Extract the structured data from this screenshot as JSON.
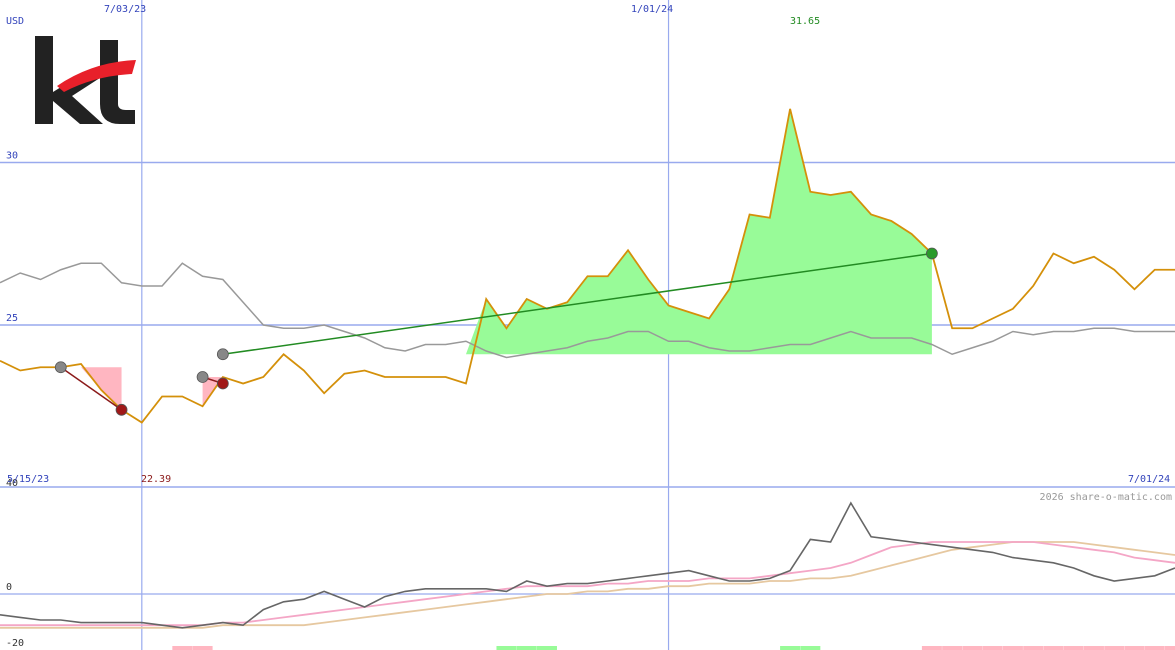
{
  "colors": {
    "price": "#d4900a",
    "benchmark": "#999999",
    "gain_fill": "#98fb98",
    "loss_fill": "#ffb6c1",
    "trend_up": "#228b22",
    "trend_down": "#8b1a1a",
    "grid": "#99aaee",
    "axis_text": "#3344bb",
    "osc": "#666666",
    "osc_ma_fast": "#f4a6c6",
    "osc_ma_slow": "#e6c8a0",
    "logo_dark": "#222222",
    "logo_red": "#e8202a"
  },
  "labels": {
    "currency": "USD",
    "top_left_date": "7/03/23",
    "top_mid_date": "1/01/24",
    "peak_value": "31.65",
    "min_value": "22.39",
    "start_date": "5/15/23",
    "end_date": "7/01/24",
    "copyright": "2026 share-o-matic.com"
  },
  "logo": {
    "text": "kt"
  },
  "chart_data": [
    {
      "type": "line",
      "y_ticks": [
        25,
        30
      ],
      "series": [
        {
          "x": [
            "5/15/23",
            "5/22/23",
            "5/29/23",
            "6/05/23",
            "6/12/23",
            "6/19/23",
            "6/26/23",
            "7/03/23",
            "7/10/23",
            "7/17/23",
            "7/24/23",
            "7/31/23",
            "8/07/23",
            "8/14/23",
            "8/21/23",
            "8/28/23",
            "9/04/23",
            "9/11/23",
            "9/18/23",
            "9/25/23",
            "10/02/23",
            "10/09/23",
            "10/16/23",
            "10/23/23",
            "10/30/23",
            "11/06/23",
            "11/13/23",
            "11/20/23",
            "11/27/23",
            "12/04/23",
            "12/11/23",
            "12/18/23",
            "12/25/23",
            "1/01/24",
            "1/08/24",
            "1/15/24",
            "1/22/24",
            "1/29/24",
            "2/05/24",
            "2/12/24",
            "2/19/24",
            "2/26/24",
            "3/04/24",
            "3/11/24",
            "3/18/24",
            "3/25/24",
            "4/01/24",
            "4/08/24",
            "4/15/24",
            "4/22/24",
            "4/29/24",
            "5/06/24",
            "5/13/24",
            "5/20/24",
            "5/27/24",
            "6/03/24",
            "6/10/24",
            "6/17/24",
            "6/24/24"
          ],
          "values": [
            23.9,
            23.6,
            23.7,
            23.7,
            23.8,
            23.0,
            22.39,
            22.0,
            22.8,
            22.8,
            22.5,
            23.4,
            23.2,
            23.4,
            24.1,
            23.6,
            22.9,
            23.5,
            23.6,
            23.4,
            23.4,
            23.4,
            23.4,
            23.2,
            25.8,
            24.9,
            25.8,
            25.5,
            25.7,
            26.5,
            26.5,
            27.3,
            26.4,
            25.6,
            25.4,
            25.2,
            26.1,
            28.4,
            28.3,
            31.65,
            29.1,
            29.0,
            29.1,
            28.4,
            28.2,
            27.8,
            27.2,
            24.9,
            24.9,
            25.2,
            25.5,
            26.2,
            27.2,
            26.9,
            27.1,
            26.7,
            26.1,
            26.7,
            26.7
          ]
        },
        {
          "x": [
            "5/15/23",
            "5/22/23",
            "5/29/23",
            "6/05/23",
            "6/12/23",
            "6/19/23",
            "6/26/23",
            "7/03/23",
            "7/10/23",
            "7/17/23",
            "7/24/23",
            "7/31/23",
            "8/07/23",
            "8/14/23",
            "8/21/23",
            "8/28/23",
            "9/04/23",
            "9/11/23",
            "9/18/23",
            "9/25/23",
            "10/02/23",
            "10/09/23",
            "10/16/23",
            "10/23/23",
            "10/30/23",
            "11/06/23",
            "11/13/23",
            "11/20/23",
            "11/27/23",
            "12/04/23",
            "12/11/23",
            "12/18/23",
            "12/25/23",
            "1/01/24",
            "1/08/24",
            "1/15/24",
            "1/22/24",
            "1/29/24",
            "2/05/24",
            "2/12/24",
            "2/19/24",
            "2/26/24",
            "3/04/24",
            "3/11/24",
            "3/18/24",
            "3/25/24",
            "4/01/24",
            "4/08/24",
            "4/15/24",
            "4/22/24",
            "4/29/24",
            "5/06/24",
            "5/13/24",
            "5/20/24",
            "5/27/24",
            "6/03/24",
            "6/10/24",
            "6/17/24",
            "6/24/24"
          ],
          "values": [
            26.3,
            26.6,
            26.4,
            26.7,
            26.9,
            26.9,
            26.3,
            26.2,
            26.2,
            26.9,
            26.5,
            26.4,
            25.7,
            25.0,
            24.9,
            24.9,
            25.0,
            24.8,
            24.6,
            24.3,
            24.2,
            24.4,
            24.4,
            24.5,
            24.2,
            24.0,
            24.1,
            24.2,
            24.3,
            24.5,
            24.6,
            24.8,
            24.8,
            24.5,
            24.5,
            24.3,
            24.2,
            24.2,
            24.3,
            24.4,
            24.4,
            24.6,
            24.8,
            24.6,
            24.6,
            24.6,
            24.4,
            24.1,
            24.3,
            24.5,
            24.8,
            24.7,
            24.8,
            24.8,
            24.9,
            24.9,
            24.8,
            24.8,
            24.8
          ]
        }
      ],
      "trend_lines": [
        {
          "from": [
            "6/05/23",
            23.7
          ],
          "to": [
            "6/26/23",
            22.39
          ],
          "direction": "down"
        },
        {
          "from": [
            "7/24/23",
            23.4
          ],
          "to": [
            "7/31/23",
            23.2
          ],
          "direction": "down"
        },
        {
          "from": [
            "7/31/23",
            24.1
          ],
          "to": [
            "4/01/24",
            27.2
          ],
          "direction": "up"
        }
      ],
      "markers": [
        {
          "x": "6/05/23",
          "y": 23.7,
          "kind": "gray"
        },
        {
          "x": "6/26/23",
          "y": 22.39,
          "kind": "red"
        },
        {
          "x": "7/24/23",
          "y": 23.4,
          "kind": "gray"
        },
        {
          "x": "7/31/23",
          "y": 23.2,
          "kind": "red"
        },
        {
          "x": "7/31/23",
          "y": 24.1,
          "kind": "gray"
        },
        {
          "x": "4/01/24",
          "y": 27.2,
          "kind": "green"
        }
      ],
      "shaded": [
        {
          "from": "6/05/23",
          "to": "6/26/23",
          "base": 23.7,
          "kind": "loss"
        },
        {
          "from": "7/24/23",
          "to": "7/31/23",
          "base": 23.4,
          "kind": "loss"
        },
        {
          "from": "7/31/23",
          "to": "4/01/24",
          "base": 24.1,
          "kind": "gain"
        }
      ]
    },
    {
      "type": "line",
      "y_ticks": [
        40,
        0,
        -20
      ],
      "series": [
        {
          "values": [
            -8,
            -9,
            -10,
            -10,
            -11,
            -11,
            -11,
            -11,
            -12,
            -13,
            -12,
            -11,
            -12,
            -6,
            -3,
            -2,
            1,
            -2,
            -5,
            -1,
            1,
            2,
            2,
            2,
            2,
            1,
            5,
            3,
            4,
            4,
            5,
            6,
            7,
            8,
            9,
            7,
            5,
            5,
            6,
            9,
            21,
            20,
            35,
            22,
            21,
            20,
            19,
            18,
            17,
            16,
            14,
            13,
            12,
            10,
            7,
            5,
            6,
            7,
            10
          ]
        },
        {
          "values": [
            -12,
            -12,
            -12,
            -12,
            -12,
            -12,
            -12,
            -12,
            -12,
            -12,
            -12,
            -11,
            -11,
            -10,
            -9,
            -8,
            -7,
            -6,
            -5,
            -4,
            -3,
            -2,
            -1,
            0,
            1,
            2,
            3,
            3,
            3,
            3,
            4,
            4,
            5,
            5,
            5,
            6,
            6,
            6,
            7,
            8,
            9,
            10,
            12,
            15,
            18,
            19,
            20,
            20,
            20,
            20,
            20,
            20,
            19,
            18,
            17,
            16,
            14,
            13,
            12
          ]
        },
        {
          "values": [
            -13,
            -13,
            -13,
            -13,
            -13,
            -13,
            -13,
            -13,
            -13,
            -13,
            -13,
            -12,
            -12,
            -12,
            -12,
            -12,
            -11,
            -10,
            -9,
            -8,
            -7,
            -6,
            -5,
            -4,
            -3,
            -2,
            -1,
            0,
            0,
            1,
            1,
            2,
            2,
            3,
            3,
            4,
            4,
            4,
            5,
            5,
            6,
            6,
            7,
            9,
            11,
            13,
            15,
            17,
            18,
            19,
            20,
            20,
            20,
            20,
            19,
            18,
            17,
            16,
            15
          ]
        }
      ],
      "bars": [
        {
          "x": "7/17/23",
          "kind": "loss"
        },
        {
          "x": "7/24/23",
          "kind": "loss"
        },
        {
          "x": "11/06/23",
          "kind": "gain"
        },
        {
          "x": "11/13/23",
          "kind": "gain"
        },
        {
          "x": "11/20/23",
          "kind": "gain"
        },
        {
          "x": "2/12/24",
          "kind": "gain"
        },
        {
          "x": "2/19/24",
          "kind": "gain"
        },
        {
          "x": "4/01/24",
          "kind": "loss"
        },
        {
          "x": "4/08/24",
          "kind": "loss"
        },
        {
          "x": "4/15/24",
          "kind": "loss"
        },
        {
          "x": "4/22/24",
          "kind": "loss"
        },
        {
          "x": "4/29/24",
          "kind": "loss"
        },
        {
          "x": "5/06/24",
          "kind": "loss"
        },
        {
          "x": "5/13/24",
          "kind": "loss"
        },
        {
          "x": "5/20/24",
          "kind": "loss"
        },
        {
          "x": "5/27/24",
          "kind": "loss"
        },
        {
          "x": "6/03/24",
          "kind": "loss"
        },
        {
          "x": "6/10/24",
          "kind": "loss"
        },
        {
          "x": "6/17/24",
          "kind": "loss"
        },
        {
          "x": "6/24/24",
          "kind": "loss"
        }
      ]
    }
  ]
}
